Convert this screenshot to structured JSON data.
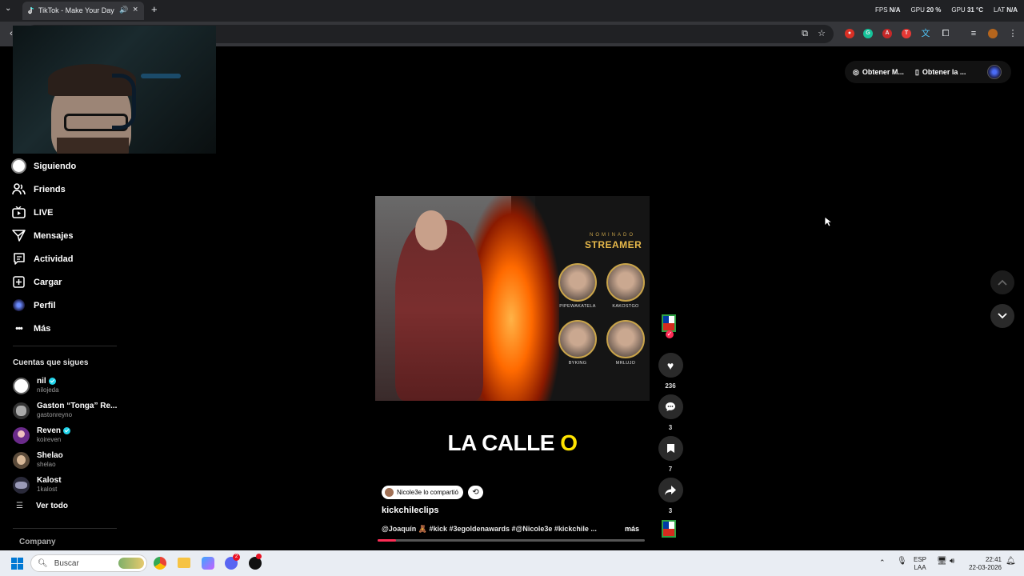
{
  "browser": {
    "tab_title": "TikTok - Make Your Day",
    "stats": [
      {
        "label": "FPS",
        "value": "N/A"
      },
      {
        "label": "GPU",
        "value": "20 %"
      },
      {
        "label": "GPU",
        "value": "31 °C"
      },
      {
        "label": "LAT",
        "value": "N/A"
      }
    ]
  },
  "top_pills": {
    "pill1": "Obtener M...",
    "pill2": "Obtener la ..."
  },
  "sidebar": {
    "nav": [
      {
        "label": "Siguiendo",
        "icon": "following-avatar-icon"
      },
      {
        "label": "Friends",
        "icon": "friends-icon"
      },
      {
        "label": "LIVE",
        "icon": "live-tv-icon"
      },
      {
        "label": "Mensajes",
        "icon": "messages-icon"
      },
      {
        "label": "Actividad",
        "icon": "activity-icon"
      },
      {
        "label": "Cargar",
        "icon": "upload-plus-icon"
      },
      {
        "label": "Perfil",
        "icon": "profile-orb-icon"
      },
      {
        "label": "Más",
        "icon": "more-dots-icon"
      }
    ],
    "following_title": "Cuentas que sigues",
    "accounts": [
      {
        "name": "nil",
        "handle": "nilojeda",
        "verified": true
      },
      {
        "name": "Gaston “Tonga” Re...",
        "handle": "gastonreyno",
        "verified": false
      },
      {
        "name": "Reven",
        "handle": "koireven",
        "verified": true
      },
      {
        "name": "Shelao",
        "handle": "shelao",
        "verified": false
      },
      {
        "name": "Kalost",
        "handle": "1kalost",
        "verified": false
      }
    ],
    "see_all": "Ver todo",
    "company": "Company"
  },
  "video": {
    "overlay_small": "NOMINADO",
    "overlay_title": "STREAMER",
    "nominees": [
      "PIPEWAKATELA",
      "KAKOSTGO",
      "BYKING",
      "MRLUJO"
    ],
    "caption_main": "LA CALLE",
    "caption_highlight": "O",
    "progress": 0.07
  },
  "actions": {
    "likes": "236",
    "comments": "3",
    "saves": "7",
    "shares": "3"
  },
  "post": {
    "shared_by": "Nicole3e lo compartió",
    "author": "kickchileclips",
    "description": "@Joaquín 🧸 #kick #3egoldenawards #@Nicole3e #kickchile ...",
    "more": "más"
  },
  "taskbar": {
    "search_placeholder": "Buscar",
    "lang": "ESP",
    "layout": "LAA",
    "time": "22:41",
    "date": "22-03-2026",
    "discord_badge": "2"
  }
}
